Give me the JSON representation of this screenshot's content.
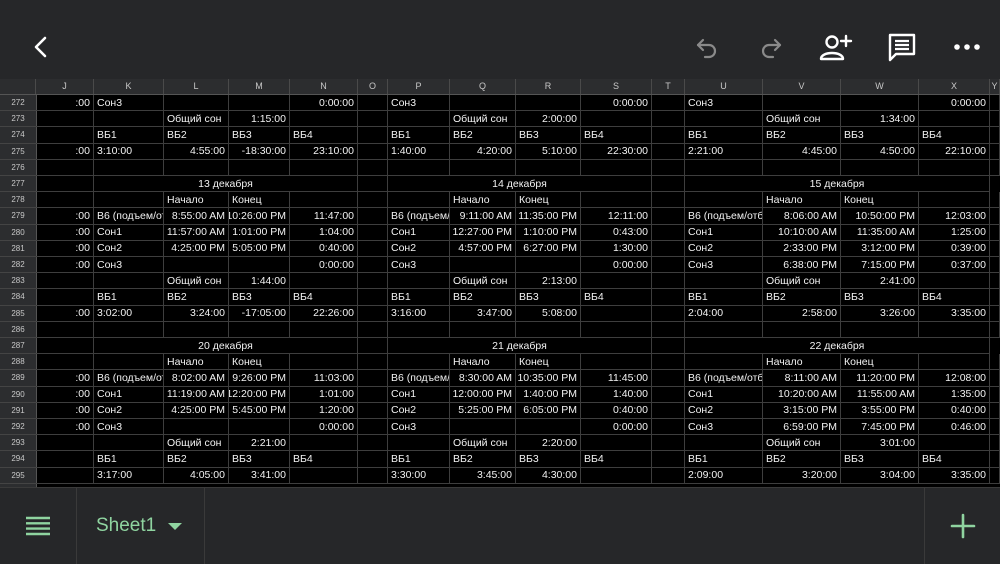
{
  "toolbar": {
    "icons": [
      "back-icon",
      "undo-icon",
      "redo-icon",
      "add-person-icon",
      "comment-icon",
      "more-icon"
    ]
  },
  "columns": [
    "J",
    "K",
    "L",
    "M",
    "N",
    "O",
    "P",
    "Q",
    "R",
    "S",
    "T",
    "U",
    "V",
    "W",
    "X",
    "Y"
  ],
  "rows": [
    {
      "num": "272",
      "cells": {
        "J": ":00",
        "K": "Сон3",
        "N": "0:00:00",
        "P": "Сон3",
        "S": "0:00:00",
        "U": "Сон3",
        "X": "0:00:00"
      }
    },
    {
      "num": "273",
      "cells": {
        "L": "Общий сон",
        "M": "1:15:00",
        "Q": "Общий сон",
        "R": "2:00:00",
        "V": "Общий сон",
        "W": "1:34:00"
      }
    },
    {
      "num": "274",
      "cells": {
        "K": "ВБ1",
        "L": "ВБ2",
        "M": "ВБ3",
        "N": "ВБ4",
        "P": "ВБ1",
        "Q": "ВБ2",
        "R": "ВБ3",
        "S": "ВБ4",
        "U": "ВБ1",
        "V": "ВБ2",
        "W": "ВБ3",
        "X": "ВБ4"
      }
    },
    {
      "num": "275",
      "cells": {
        "J": ":00",
        "K": "3:10:00",
        "L": "4:55:00",
        "M": "-18:30:00",
        "N": "23:10:00",
        "P": "1:40:00",
        "Q": "4:20:00",
        "R": "5:10:00",
        "S": "22:30:00",
        "U": "2:21:00",
        "V": "4:45:00",
        "W": "4:50:00",
        "X": "22:10:00"
      }
    },
    {
      "num": "276",
      "cells": {}
    },
    {
      "num": "277",
      "cells": {},
      "dates": [
        "13 декабря",
        "14 декабря",
        "15 декабря"
      ]
    },
    {
      "num": "278",
      "cells": {
        "L": "Начало",
        "M": "Конец",
        "Q": "Начало",
        "R": "Конец",
        "V": "Начало",
        "W": "Конец"
      }
    },
    {
      "num": "279",
      "cells": {
        "J": ":00",
        "K": "В6 (подъем/от",
        "L": "8:55:00 AM",
        "M": "10:26:00 PM",
        "N": "11:47:00",
        "P": "В6 (подъем/от",
        "Q": "9:11:00 AM",
        "R": "11:35:00 PM",
        "S": "12:11:00",
        "U": "В6 (подъем/отб",
        "V": "8:06:00 AM",
        "W": "10:50:00 PM",
        "X": "12:03:00"
      }
    },
    {
      "num": "280",
      "cells": {
        "J": ":00",
        "K": "Сон1",
        "L": "11:57:00 AM",
        "M": "1:01:00 PM",
        "N": "1:04:00",
        "P": "Сон1",
        "Q": "12:27:00 PM",
        "R": "1:10:00 PM",
        "S": "0:43:00",
        "U": "Сон1",
        "V": "10:10:00 AM",
        "W": "11:35:00 AM",
        "X": "1:25:00"
      }
    },
    {
      "num": "281",
      "cells": {
        "J": ":00",
        "K": "Сон2",
        "L": "4:25:00 PM",
        "M": "5:05:00 PM",
        "N": "0:40:00",
        "P": "Сон2",
        "Q": "4:57:00 PM",
        "R": "6:27:00 PM",
        "S": "1:30:00",
        "U": "Сон2",
        "V": "2:33:00 PM",
        "W": "3:12:00 PM",
        "X": "0:39:00"
      }
    },
    {
      "num": "282",
      "cells": {
        "J": ":00",
        "K": "Сон3",
        "N": "0:00:00",
        "P": "Сон3",
        "S": "0:00:00",
        "U": "Сон3",
        "V": "6:38:00 PM",
        "W": "7:15:00 PM",
        "X": "0:37:00"
      }
    },
    {
      "num": "283",
      "cells": {
        "L": "Общий сон",
        "M": "1:44:00",
        "Q": "Общий сон",
        "R": "2:13:00",
        "V": "Общий сон",
        "W": "2:41:00"
      }
    },
    {
      "num": "284",
      "cells": {
        "K": "ВБ1",
        "L": "ВБ2",
        "M": "ВБ3",
        "N": "ВБ4",
        "P": "ВБ1",
        "Q": "ВБ2",
        "R": "ВБ3",
        "S": "ВБ4",
        "U": "ВБ1",
        "V": "ВБ2",
        "W": "ВБ3",
        "X": "ВБ4"
      }
    },
    {
      "num": "285",
      "cells": {
        "J": ":00",
        "K": "3:02:00",
        "L": "3:24:00",
        "M": "-17:05:00",
        "N": "22:26:00",
        "P": "3:16:00",
        "Q": "3:47:00",
        "R": "5:08:00",
        "U": "2:04:00",
        "V": "2:58:00",
        "W": "3:26:00",
        "X": "3:35:00"
      }
    },
    {
      "num": "286",
      "cells": {}
    },
    {
      "num": "287",
      "cells": {},
      "dates": [
        "20 декабря",
        "21 декабря",
        "22 декабря"
      ]
    },
    {
      "num": "288",
      "cells": {
        "L": "Начало",
        "M": "Конец",
        "Q": "Начало",
        "R": "Конец",
        "V": "Начало",
        "W": "Конец"
      }
    },
    {
      "num": "289",
      "cells": {
        "J": ":00",
        "K": "В6 (подъем/от",
        "L": "8:02:00 AM",
        "M": "9:26:00 PM",
        "N": "11:03:00",
        "P": "В6 (подъем/от",
        "Q": "8:30:00 AM",
        "R": "10:35:00 PM",
        "S": "11:45:00",
        "U": "В6 (подъем/отб",
        "V": "8:11:00 AM",
        "W": "11:20:00 PM",
        "X": "12:08:00"
      }
    },
    {
      "num": "290",
      "cells": {
        "J": ":00",
        "K": "Сон1",
        "L": "11:19:00 AM",
        "M": "12:20:00 PM",
        "N": "1:01:00",
        "P": "Сон1",
        "Q": "12:00:00 PM",
        "R": "1:40:00 PM",
        "S": "1:40:00",
        "U": "Сон1",
        "V": "10:20:00 AM",
        "W": "11:55:00 AM",
        "X": "1:35:00"
      }
    },
    {
      "num": "291",
      "cells": {
        "J": ":00",
        "K": "Сон2",
        "L": "4:25:00 PM",
        "M": "5:45:00 PM",
        "N": "1:20:00",
        "P": "Сон2",
        "Q": "5:25:00 PM",
        "R": "6:05:00 PM",
        "S": "0:40:00",
        "U": "Сон2",
        "V": "3:15:00 PM",
        "W": "3:55:00 PM",
        "X": "0:40:00"
      }
    },
    {
      "num": "292",
      "cells": {
        "J": ":00",
        "K": "Сон3",
        "N": "0:00:00",
        "P": "Сон3",
        "S": "0:00:00",
        "U": "Сон3",
        "V": "6:59:00 PM",
        "W": "7:45:00 PM",
        "X": "0:46:00"
      }
    },
    {
      "num": "293",
      "cells": {
        "L": "Общий сон",
        "M": "2:21:00",
        "Q": "Общий сон",
        "R": "2:20:00",
        "V": "Общий сон",
        "W": "3:01:00"
      }
    },
    {
      "num": "294",
      "cells": {
        "K": "ВБ1",
        "L": "ВБ2",
        "M": "ВБ3",
        "N": "ВБ4",
        "P": "ВБ1",
        "Q": "ВБ2",
        "R": "ВБ3",
        "S": "ВБ4",
        "U": "ВБ1",
        "V": "ВБ2",
        "W": "ВБ3",
        "X": "ВБ4"
      }
    },
    {
      "num": "295",
      "cells": {
        "K": "3:17:00",
        "L": "4:05:00",
        "M": "3:41:00",
        "P": "3:30:00",
        "Q": "3:45:00",
        "R": "4:30:00",
        "U": "2:09:00",
        "V": "3:20:00",
        "W": "3:04:00",
        "X": "3:35:00"
      }
    }
  ],
  "bottom": {
    "sheet_tab": "Sheet1"
  },
  "colors": {
    "accent": "#8fd4a0",
    "toolbar_bg": "#262729",
    "grid_bg": "#000000"
  }
}
